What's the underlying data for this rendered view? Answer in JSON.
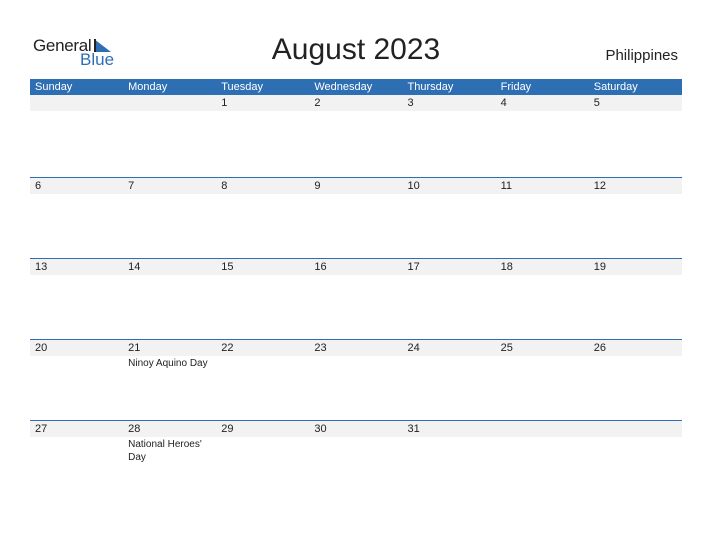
{
  "logo": {
    "general": "General",
    "blue": "Blue"
  },
  "title": "August 2023",
  "country": "Philippines",
  "colors": {
    "accent": "#2e6fb4",
    "date_row_bg": "#f2f2f2"
  },
  "days": [
    "Sunday",
    "Monday",
    "Tuesday",
    "Wednesday",
    "Thursday",
    "Friday",
    "Saturday"
  ],
  "weeks": [
    {
      "dates": [
        "",
        "",
        "1",
        "2",
        "3",
        "4",
        "5"
      ],
      "events": [
        "",
        "",
        "",
        "",
        "",
        "",
        ""
      ]
    },
    {
      "dates": [
        "6",
        "7",
        "8",
        "9",
        "10",
        "11",
        "12"
      ],
      "events": [
        "",
        "",
        "",
        "",
        "",
        "",
        ""
      ]
    },
    {
      "dates": [
        "13",
        "14",
        "15",
        "16",
        "17",
        "18",
        "19"
      ],
      "events": [
        "",
        "",
        "",
        "",
        "",
        "",
        ""
      ]
    },
    {
      "dates": [
        "20",
        "21",
        "22",
        "23",
        "24",
        "25",
        "26"
      ],
      "events": [
        "",
        "Ninoy Aquino Day",
        "",
        "",
        "",
        "",
        ""
      ]
    },
    {
      "dates": [
        "27",
        "28",
        "29",
        "30",
        "31",
        "",
        ""
      ],
      "events": [
        "",
        "National Heroes' Day",
        "",
        "",
        "",
        "",
        ""
      ]
    }
  ]
}
